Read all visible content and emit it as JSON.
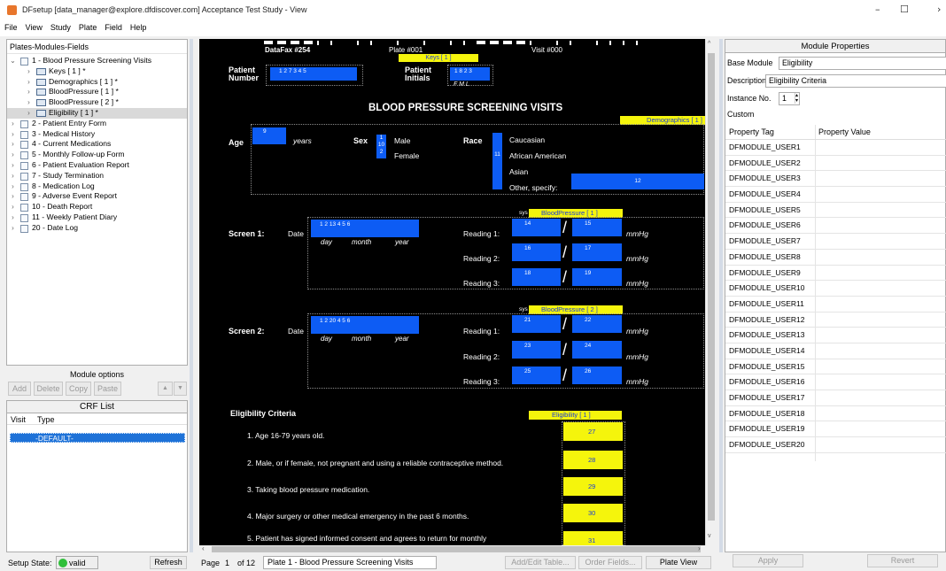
{
  "window": {
    "title": "DFsetup [data_manager@explore.dfdiscover.com] Acceptance Test Study - View",
    "min": "–",
    "max": "☐",
    "close": "✕"
  },
  "menu": [
    "File",
    "View",
    "Study",
    "Plate",
    "Field",
    "Help"
  ],
  "tree": {
    "header": "Plates-Modules-Fields",
    "items": [
      {
        "label": "1 - Blood Pressure Screening Visits",
        "level": 0,
        "type": "plate",
        "expanded": true
      },
      {
        "label": "Keys [ 1 ] *",
        "level": 1,
        "type": "module"
      },
      {
        "label": "Demographics [ 1 ] *",
        "level": 1,
        "type": "module"
      },
      {
        "label": "BloodPressure [ 1 ] *",
        "level": 1,
        "type": "module"
      },
      {
        "label": "BloodPressure [ 2 ] *",
        "level": 1,
        "type": "module"
      },
      {
        "label": "Eligibility [ 1 ] *",
        "level": 1,
        "type": "module",
        "selected": true
      },
      {
        "label": "2 - Patient Entry Form",
        "level": 0,
        "type": "plate"
      },
      {
        "label": "3 - Medical History",
        "level": 0,
        "type": "plate"
      },
      {
        "label": "4 - Current Medications",
        "level": 0,
        "type": "plate"
      },
      {
        "label": "5 - Monthly Follow-up Form",
        "level": 0,
        "type": "plate"
      },
      {
        "label": "6 - Patient Evaluation Report",
        "level": 0,
        "type": "plate"
      },
      {
        "label": "7 - Study Termination",
        "level": 0,
        "type": "plate"
      },
      {
        "label": "8 - Medication Log",
        "level": 0,
        "type": "plate"
      },
      {
        "label": "9 - Adverse Event Report",
        "level": 0,
        "type": "plate"
      },
      {
        "label": "10 - Death Report",
        "level": 0,
        "type": "plate"
      },
      {
        "label": "11 - Weekly Patient Diary",
        "level": 0,
        "type": "plate"
      },
      {
        "label": "20 - Date Log",
        "level": 0,
        "type": "plate"
      }
    ]
  },
  "module_options": {
    "label": "Module options",
    "buttons": [
      "Add",
      "Delete",
      "Copy",
      "Paste"
    ],
    "up": "▲",
    "down": "▼"
  },
  "crf": {
    "title": "CRF List",
    "col_visit": "Visit",
    "col_type": "Type",
    "selected_row": "-DEFAULT-"
  },
  "status": {
    "label": "Setup State:",
    "value": "valid",
    "refresh": "Refresh"
  },
  "bottom": {
    "page_label": "Page",
    "page_num": "1",
    "of_label": "of 12",
    "plate_name": "Plate 1 - Blood Pressure Screening Visits",
    "add_edit": "Add/Edit Table...",
    "order": "Order Fields...",
    "plate_view": "Plate View"
  },
  "props": {
    "title": "Module Properties",
    "base_module_label": "Base Module",
    "base_module": "Eligibility",
    "description_label": "Description",
    "description": "Eligibility Criteria",
    "instance_label": "Instance No.",
    "instance": "1",
    "custom_label": "Custom",
    "tag_col": "Property Tag",
    "value_col": "Property Value",
    "tags": [
      "DFMODULE_USER1",
      "DFMODULE_USER2",
      "DFMODULE_USER3",
      "DFMODULE_USER4",
      "DFMODULE_USER5",
      "DFMODULE_USER6",
      "DFMODULE_USER7",
      "DFMODULE_USER8",
      "DFMODULE_USER9",
      "DFMODULE_USER10",
      "DFMODULE_USER11",
      "DFMODULE_USER12",
      "DFMODULE_USER13",
      "DFMODULE_USER14",
      "DFMODULE_USER15",
      "DFMODULE_USER16",
      "DFMODULE_USER17",
      "DFMODULE_USER18",
      "DFMODULE_USER19",
      "DFMODULE_USER20"
    ],
    "apply": "Apply",
    "revert": "Revert"
  },
  "plate": {
    "datafax": "DataFax #254",
    "plate_no": "Plate #001",
    "visit": "Visit #000",
    "keys_tag": "Keys [ 1 ]",
    "patient_number": "Patient\nNumber",
    "patient_initials": "Patient\nInitials",
    "fml": "F  M  L",
    "heading": "BLOOD PRESSURE SCREENING VISITS",
    "demographics_tag": "Demographics [ 1 ]",
    "age": "Age",
    "years": "years",
    "sex": "Sex",
    "male": "Male",
    "female": "Female",
    "race": "Race",
    "race_opts": [
      "Caucasian",
      "African American",
      "Asian",
      "Other, specify:"
    ],
    "bp1_tag": "BloodPressure [ 1 ]",
    "bp2_tag": "BloodPressure [ 2 ]",
    "screen1": "Screen 1:",
    "screen2": "Screen 2:",
    "date": "Date",
    "day": "day",
    "month": "month",
    "year": "year",
    "reading1": "Reading 1:",
    "reading2": "Reading 2:",
    "reading3": "Reading 3:",
    "mmhg": "mmHg",
    "sys": "sys",
    "elig_heading": "Eligibility Criteria",
    "elig_tag": "Eligibility [ 1 ]",
    "criteria": [
      "1.   Age 16-79 years old.",
      "2.   Male, or if female, not pregnant and using a reliable contraceptive method.",
      "3.   Taking blood pressure medication.",
      "4.   Major surgery or other medical emergency in the past 6 months.",
      "5.   Patient has signed informed consent and agrees to return for monthly"
    ],
    "elig_fields": [
      "27",
      "28",
      "29",
      "30",
      "31"
    ],
    "field_nums": {
      "pn": "1   2   7  3   4   5",
      "pi": "1   8  2   3",
      "age": "9",
      "sex1": "1",
      "sex2": "2",
      "sex10": "10",
      "race11": "11",
      "other": "12",
      "s1d": "1    2    13   4    5    6",
      "s1r": [
        "14",
        "15",
        "16",
        "17",
        "18",
        "19"
      ],
      "s2d": "1    2    20   4    5    6",
      "s2r": [
        "21",
        "22",
        "23",
        "24",
        "25",
        "26"
      ]
    }
  }
}
